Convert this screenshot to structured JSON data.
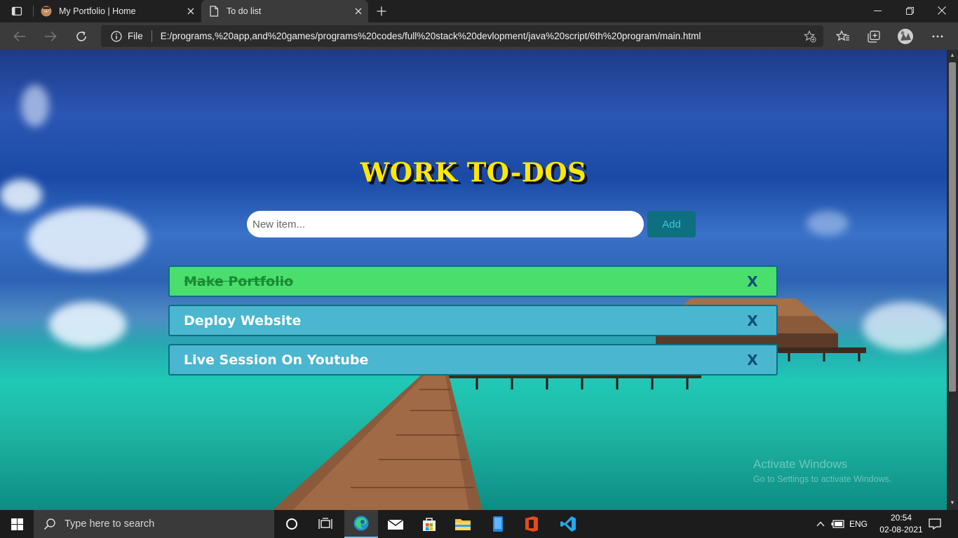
{
  "browser": {
    "tabs": [
      {
        "title": "My Portfolio | Home",
        "favicon": "avatar-favicon",
        "active": false
      },
      {
        "title": "To do list",
        "favicon": "page-icon",
        "active": true
      }
    ],
    "address": {
      "scheme_label": "File",
      "url": "E:/programs,%20app,and%20games/programs%20codes/full%20stack%20devlopment/java%20script/6th%20program/main.html"
    }
  },
  "page": {
    "title": "WORK TO-DOS",
    "input_placeholder": "New item...",
    "add_label": "Add",
    "todos": [
      {
        "text": "Make Portfolio",
        "done": true,
        "delete_label": "X"
      },
      {
        "text": "Deploy Website",
        "done": false,
        "delete_label": "X"
      },
      {
        "text": "Live Session On Youtube",
        "done": false,
        "delete_label": "X"
      }
    ],
    "colors": {
      "title": "#ffe800",
      "done_item": "#4ade6d",
      "pending_item": "#4ab6cf",
      "add_button": "#0e6f7f"
    }
  },
  "watermark": {
    "title": "Activate Windows",
    "subtitle": "Go to Settings to activate Windows."
  },
  "taskbar": {
    "search_placeholder": "Type here to search",
    "language": "ENG",
    "time": "20:54",
    "date": "02-08-2021"
  }
}
